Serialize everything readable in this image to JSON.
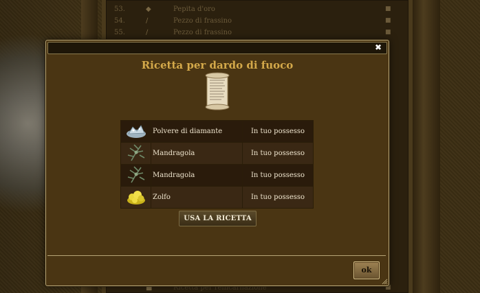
{
  "background": {
    "rows_top": [
      {
        "num": "53.",
        "name": "Pepita d'oro"
      },
      {
        "num": "54.",
        "name": "Pezzo di frassino"
      },
      {
        "num": "55.",
        "name": "Pezzo di frassino"
      }
    ],
    "rows_bottom": [
      {
        "num": "",
        "name": "Ricetta per reincarnazione"
      }
    ]
  },
  "dialog": {
    "title": "Ricetta per dardo di fuoco",
    "close_icon": "close-icon",
    "ingredients": [
      {
        "name": "Polvere di diamante",
        "status": "In tuo possesso",
        "icon": "diamond-dust-icon"
      },
      {
        "name": "Mandragola",
        "status": "In tuo possesso",
        "icon": "mandrake-icon"
      },
      {
        "name": "Mandragola",
        "status": "In tuo possesso",
        "icon": "mandrake-icon"
      },
      {
        "name": "Zolfo",
        "status": "In tuo possesso",
        "icon": "sulfur-icon"
      }
    ],
    "use_button": "USA LA RICETTA",
    "ok_button": "ok"
  },
  "colors": {
    "accent_title": "#d4a94a",
    "dialog_bg": "#4a3513",
    "border": "#b7a677"
  }
}
